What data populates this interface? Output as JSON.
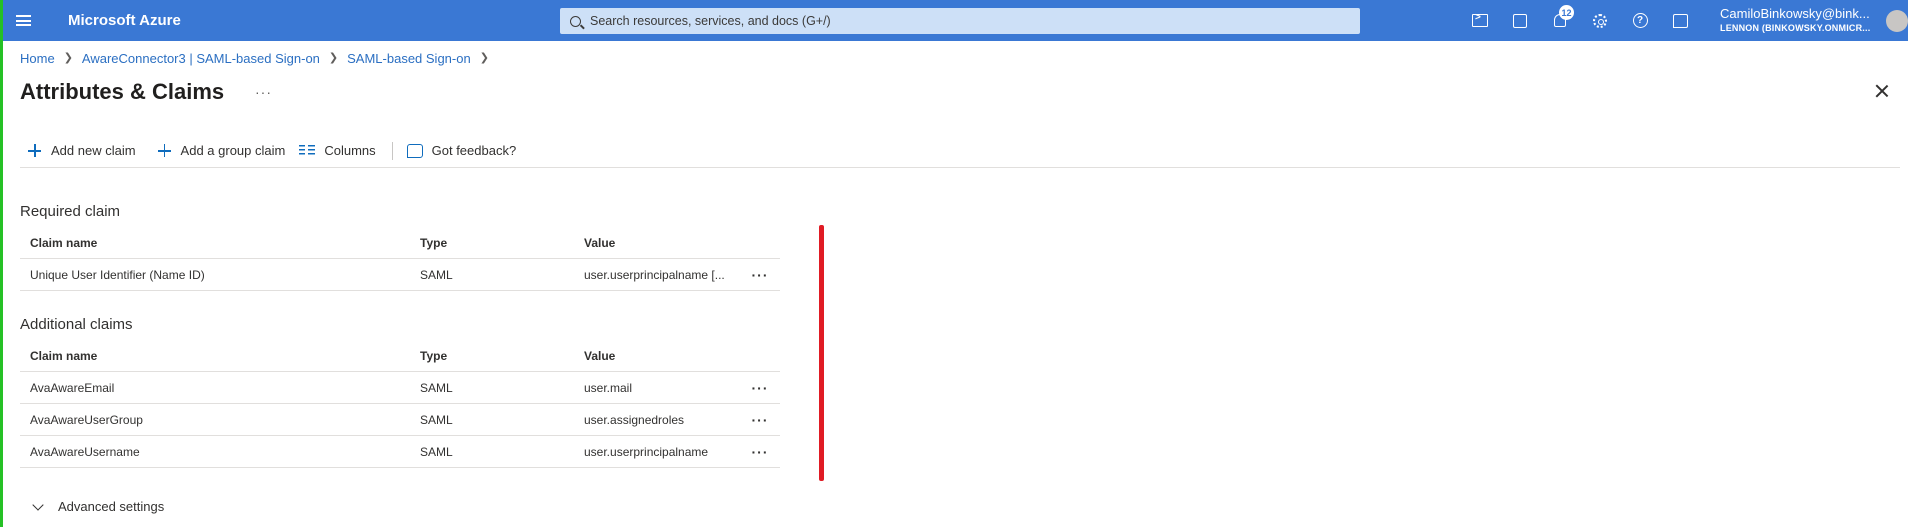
{
  "app": {
    "brand": "Microsoft Azure",
    "search_placeholder": "Search resources, services, and docs (G+/)",
    "notification_count": "12",
    "account_name": "CamiloBinkowsky@bink...",
    "account_directory": "LENNON (BINKOWSKY.ONMICR..."
  },
  "breadcrumb": [
    "Home",
    "AwareConnector3 | SAML-based Sign-on",
    "SAML-based Sign-on"
  ],
  "page": {
    "title": "Attributes & Claims",
    "more": "···"
  },
  "toolbar": {
    "add_new_claim": "Add new claim",
    "add_group_claim": "Add a group claim",
    "columns": "Columns",
    "feedback": "Got feedback?"
  },
  "required": {
    "title": "Required claim",
    "headers": [
      "Claim name",
      "Type",
      "Value"
    ],
    "rows": [
      {
        "name": "Unique User Identifier (Name ID)",
        "type": "SAML",
        "value": "user.userprincipalname [..."
      }
    ]
  },
  "additional": {
    "title": "Additional claims",
    "headers": [
      "Claim name",
      "Type",
      "Value"
    ],
    "rows": [
      {
        "name": "AvaAwareEmail",
        "type": "SAML",
        "value": "user.mail"
      },
      {
        "name": "AvaAwareUserGroup",
        "type": "SAML",
        "value": "user.assignedroles"
      },
      {
        "name": "AvaAwareUsername",
        "type": "SAML",
        "value": "user.userprincipalname"
      }
    ]
  },
  "advanced_settings": "Advanced settings",
  "row_more": "···",
  "colors": {
    "topbar": "#3a78d4",
    "accent_left": "#25c125",
    "marker": "#e01b24",
    "link": "#2b6fc2"
  }
}
